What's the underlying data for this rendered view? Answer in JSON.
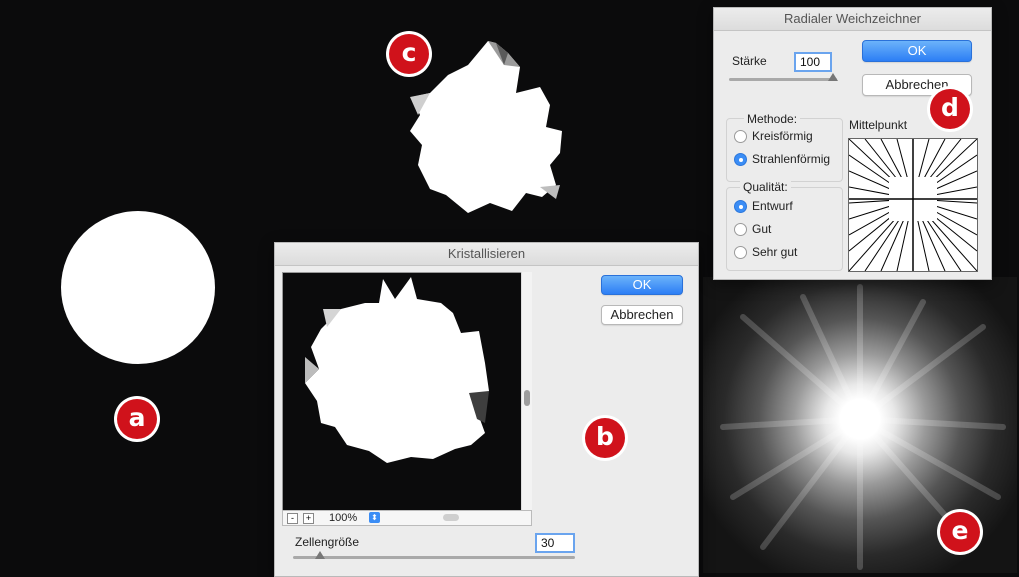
{
  "badges": {
    "a": "a",
    "b": "b",
    "c": "c",
    "d": "d",
    "e": "e"
  },
  "kristallisieren": {
    "title": "Kristallisieren",
    "ok_label": "OK",
    "cancel_label": "Abbrechen",
    "zoom_value": "100%",
    "cell_size_label": "Zellengröße",
    "cell_size_value": "30",
    "zoom_out_label": "-",
    "zoom_in_label": "+"
  },
  "radial": {
    "title": "Radialer Weichzeichner",
    "amount_label": "Stärke",
    "amount_value": "100",
    "ok_label": "OK",
    "cancel_label": "Abbrechen",
    "method_label": "Methode:",
    "method_options": [
      "Kreisförmig",
      "Strahlenförmig"
    ],
    "quality_label": "Qualität:",
    "quality_options": [
      "Entwurf",
      "Gut",
      "Sehr gut"
    ],
    "center_label": "Mittelpunkt"
  },
  "colors": {
    "badge": "#d0121b",
    "accent": "#3b8df5",
    "background": "#0b0b0c"
  }
}
